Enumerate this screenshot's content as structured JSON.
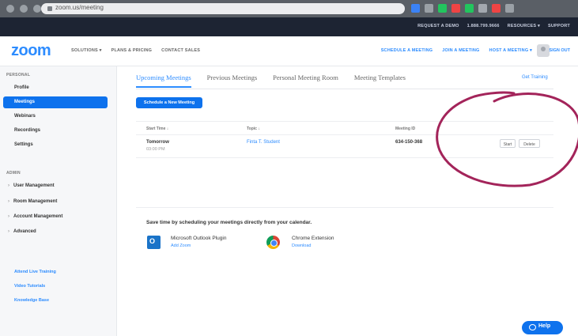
{
  "browser": {
    "url": "zoom.us/meeting",
    "extension_colors": [
      "#3b82f6",
      "#9aa0a6",
      "#22c55e",
      "#ef4444",
      "#22c55e",
      "#a3a8af",
      "#ef4444",
      "#9aa0a6"
    ]
  },
  "util_bar": {
    "links": [
      "REQUEST A DEMO",
      "1.888.799.9666",
      "RESOURCES ▾",
      "SUPPORT"
    ]
  },
  "header": {
    "logo": "zoom",
    "nav": [
      "SOLUTIONS ▾",
      "PLANS & PRICING",
      "CONTACT SALES"
    ],
    "right_nav": [
      "SCHEDULE A MEETING",
      "JOIN A MEETING",
      "HOST A MEETING ▾"
    ],
    "signout": "SIGN OUT"
  },
  "sidebar": {
    "personal_label": "PERSONAL",
    "items": [
      {
        "label": "Profile",
        "active": false
      },
      {
        "label": "Meetings",
        "active": true
      },
      {
        "label": "Webinars",
        "active": false
      },
      {
        "label": "Recordings",
        "active": false
      },
      {
        "label": "Settings",
        "active": false
      }
    ],
    "admin_label": "ADMIN",
    "admin_items": [
      "User Management",
      "Room Management",
      "Account Management",
      "Advanced"
    ],
    "links": [
      "Attend Live Training",
      "Video Tutorials",
      "Knowledge Base"
    ]
  },
  "main": {
    "tabs": [
      "Upcoming Meetings",
      "Previous Meetings",
      "Personal Meeting Room",
      "Meeting Templates"
    ],
    "get_training": "Get Training",
    "schedule_button": "Schedule a New Meeting",
    "table": {
      "headers": [
        "Start Time ↓",
        "Topic ↓",
        "Meeting ID"
      ],
      "row": {
        "time": "Tomorrow",
        "time_detail": "03:00 PM",
        "topic": "Finta T. Student",
        "meeting_id": "634-150-368",
        "start": "Start",
        "delete": "Delete"
      }
    },
    "promo": {
      "title": "Save time by scheduling your meetings directly from your calendar.",
      "outlook_name": "Microsoft Outlook Plugin",
      "outlook_link": "Add Zoom",
      "chrome_name": "Chrome Extension",
      "chrome_link": "Download"
    },
    "help": "Help"
  }
}
